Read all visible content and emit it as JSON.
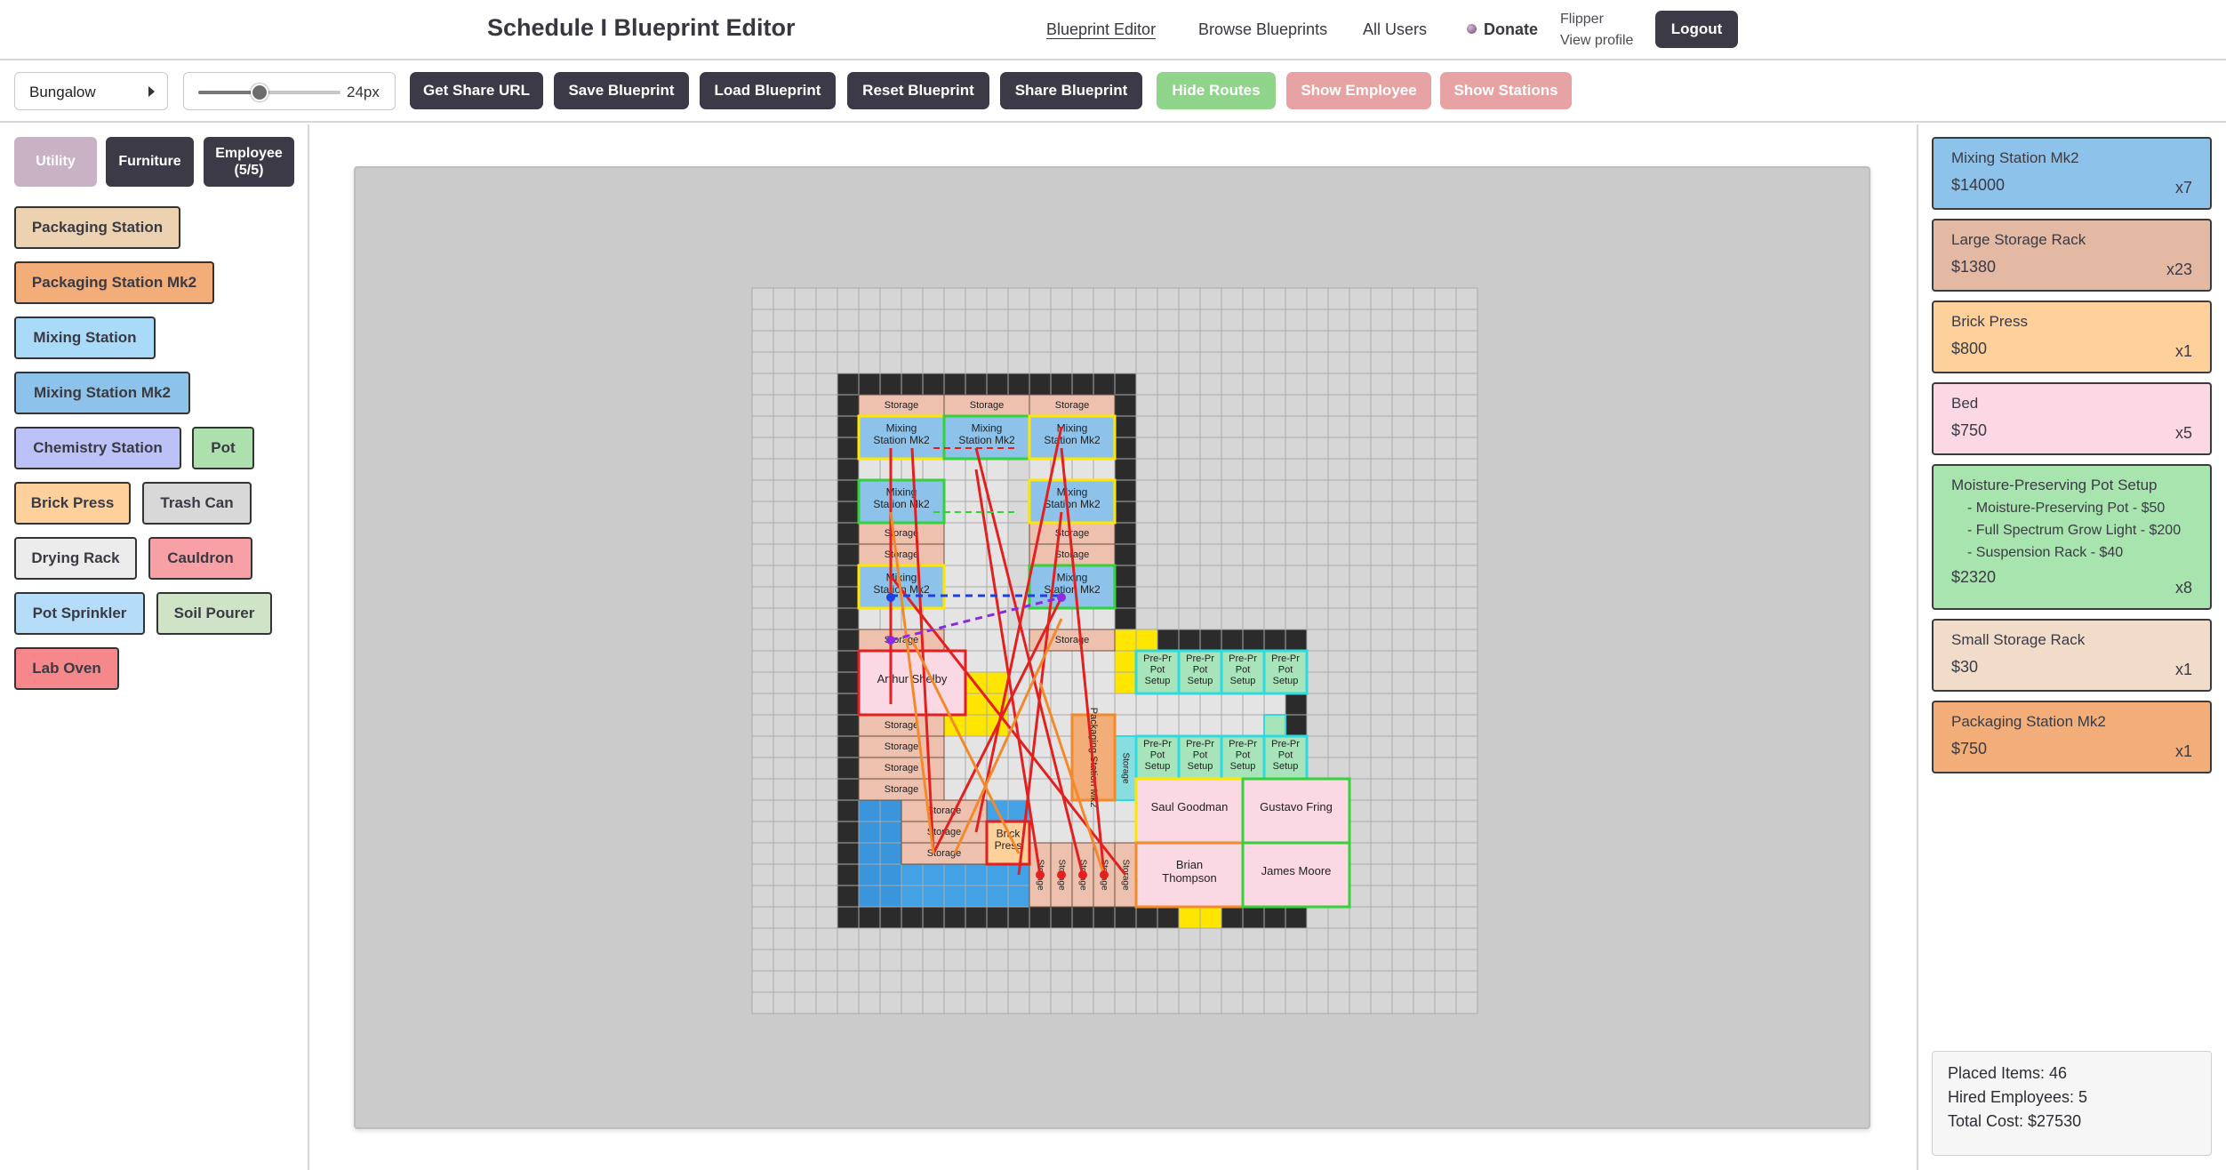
{
  "header": {
    "title": "Schedule I Blueprint Editor",
    "nav": [
      "Blueprint Editor",
      "Browse Blueprints",
      "All Users"
    ],
    "donate": "Donate",
    "user_name": "Flipper",
    "profile_link": "View profile",
    "logout": "Logout"
  },
  "toolbar": {
    "layout_value": "Bungalow",
    "zoom_value": "24px",
    "zoom_fraction": 0.43,
    "buttons": [
      "Get Share URL",
      "Save Blueprint",
      "Load Blueprint",
      "Reset Blueprint",
      "Share Blueprint",
      "Hide Routes",
      "Show Employee",
      "Show Stations"
    ]
  },
  "sidebar": {
    "tabs": [
      "Utility",
      "Furniture",
      "Employee (5/5)"
    ],
    "items": [
      {
        "label": "Packaging Station",
        "color": "#ecd2b0"
      },
      {
        "label": "Packaging Station Mk2",
        "color": "#f2ad79"
      },
      {
        "label": "Mixing Station",
        "color": "#a9dbf8"
      },
      {
        "label": "Mixing Station Mk2",
        "color": "#8dc3ea"
      },
      {
        "label": "Chemistry Station",
        "color": "#bcc1f7"
      },
      {
        "label": "Pot",
        "color": "#ace0ad"
      },
      {
        "label": "Brick Press",
        "color": "#fdd09c"
      },
      {
        "label": "Trash Can",
        "color": "#d8d8d8"
      },
      {
        "label": "Drying Rack",
        "color": "#ececec"
      },
      {
        "label": "Cauldron",
        "color": "#f7a0a6"
      },
      {
        "label": "Pot Sprinkler",
        "color": "#b5dcf8"
      },
      {
        "label": "Soil Pourer",
        "color": "#cfe4c7"
      },
      {
        "label": "Lab Oven",
        "color": "#f6888b"
      }
    ]
  },
  "blueprint": {
    "labels": {
      "storage": "Storage",
      "mixing": "Mixing Station Mk2",
      "packaging": "Packaging Station Mk2",
      "pot": "Pre-Press Pot Setup",
      "brick": "Brick Press"
    },
    "employees": [
      "Arthur Shelby",
      "Saul Goodman",
      "Gustavo Fring",
      "Brian Thompson",
      "James Moore"
    ],
    "colors": {
      "storage": "#eec0ae",
      "mixing": "#8dc3ea",
      "bed": "#fbd9e4",
      "pot": "#a8e4ba",
      "packaging": "#f2ad79",
      "brick": "#fdd09c",
      "wall": "#2b2b2b",
      "floor": "#e4e4e4",
      "water": "#43a1e6",
      "highlight": "#ffe600"
    }
  },
  "summary_list": [
    {
      "name": "Mixing Station Mk2",
      "price": "$14000",
      "qty": "x7",
      "color": "#8dc3ea"
    },
    {
      "name": "Large Storage Rack",
      "price": "$1380",
      "qty": "x23",
      "color": "#e3b9a4"
    },
    {
      "name": "Brick Press",
      "price": "$800",
      "qty": "x1",
      "color": "#fdd09c"
    },
    {
      "name": "Bed",
      "price": "$750",
      "qty": "x5",
      "color": "#fbd8e4"
    },
    {
      "name": "Moisture-Preserving Pot Setup",
      "price": "$2320",
      "qty": "x8",
      "color": "#a8e4ad",
      "subs": [
        "- Moisture-Preserving Pot - $50",
        "- Full Spectrum Grow Light - $200",
        "- Suspension Rack - $40"
      ]
    },
    {
      "name": "Small Storage Rack",
      "price": "$30",
      "qty": "x1",
      "color": "#f1dcc9"
    },
    {
      "name": "Packaging Station Mk2",
      "price": "$750",
      "qty": "x1",
      "color": "#f2ad79"
    }
  ],
  "totals": {
    "placed": "Placed Items: 46",
    "employees": "Hired Employees: 5",
    "cost": "Total Cost: $27530"
  }
}
